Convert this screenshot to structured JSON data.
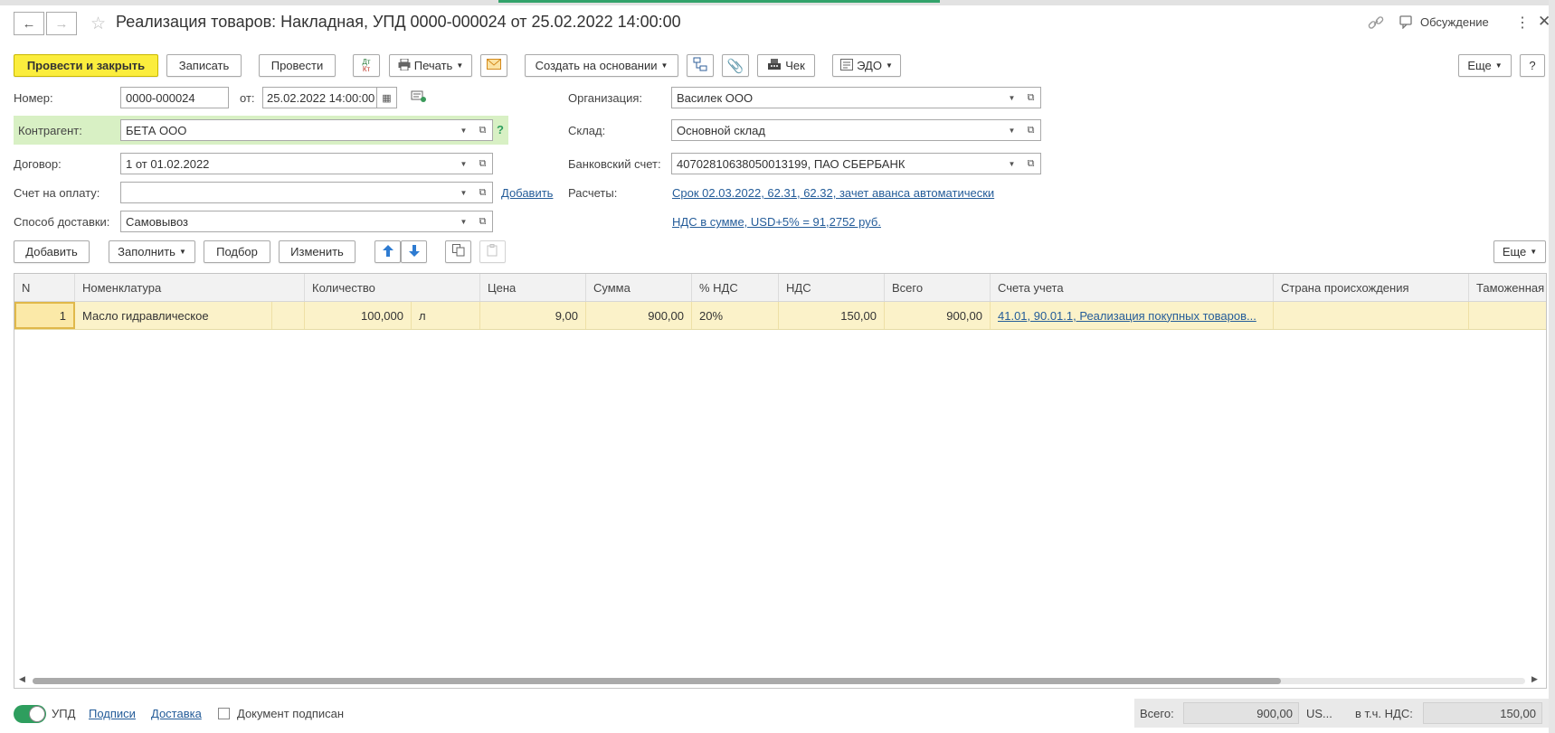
{
  "window": {
    "title": "Реализация товаров: Накладная, УПД 0000-000024 от 25.02.2022 14:00:00",
    "discussion_label": "Обсуждение"
  },
  "toolbar": {
    "post_close": "Провести и закрыть",
    "save": "Записать",
    "post": "Провести",
    "dtkt_top": "Дт",
    "dtkt_bottom": "Кт",
    "print": "Печать",
    "create_based": "Создать на основании",
    "check": "Чек",
    "edo": "ЭДО",
    "more": "Еще",
    "help": "?"
  },
  "form": {
    "number_label": "Номер:",
    "number_value": "0000-000024",
    "from_label": "от:",
    "date_value": "25.02.2022 14:00:00",
    "counterparty_label": "Контрагент:",
    "counterparty_value": "БЕТА ООО",
    "counterparty_hint": "?",
    "contract_label": "Договор:",
    "contract_value": "1 от 01.02.2022",
    "invoice_label": "Счет на оплату:",
    "invoice_value": "",
    "invoice_add": "Добавить",
    "delivery_label": "Способ доставки:",
    "delivery_value": "Самовывоз",
    "org_label": "Организация:",
    "org_value": "Василек ООО",
    "warehouse_label": "Склад:",
    "warehouse_value": "Основной склад",
    "bank_label": "Банковский счет:",
    "bank_value": "40702810638050013199, ПАО СБЕРБАНК",
    "settlements_label": "Расчеты:",
    "settlements_link": "Срок 02.03.2022, 62.31, 62.32, зачет аванса автоматически",
    "vat_link": "НДС в сумме, USD+5% = 91,2752 руб."
  },
  "table_toolbar": {
    "add": "Добавить",
    "fill": "Заполнить",
    "select": "Подбор",
    "change": "Изменить",
    "more": "Еще"
  },
  "table": {
    "columns": [
      "N",
      "Номенклатура",
      "Количество",
      "Цена",
      "Сумма",
      "% НДС",
      "НДС",
      "Всего",
      "Счета учета",
      "Страна происхождения",
      "Таможенная"
    ],
    "rows": [
      {
        "n": "1",
        "item": "Масло гидравлическое",
        "qty": "100,000",
        "unit": "л",
        "price": "9,00",
        "sum": "900,00",
        "vat_rate": "20%",
        "vat": "150,00",
        "total": "900,00",
        "accounts": "41.01, 90.01.1, Реализация покупных товаров..."
      }
    ]
  },
  "footer": {
    "upd_label": "УПД",
    "signatures": "Подписи",
    "delivery": "Доставка",
    "signed_label": "Документ подписан",
    "total_label": "Всего:",
    "total_value": "900,00",
    "currency": "US...",
    "vat_label": "в т.ч. НДС:",
    "vat_value": "150,00"
  },
  "colors": {
    "primary_button": "#fbed3d",
    "counterparty_highlight": "#d8f0c4",
    "selected_row": "#fbf2c9",
    "link": "#245c99",
    "toggle_on": "#2e9e5e"
  }
}
